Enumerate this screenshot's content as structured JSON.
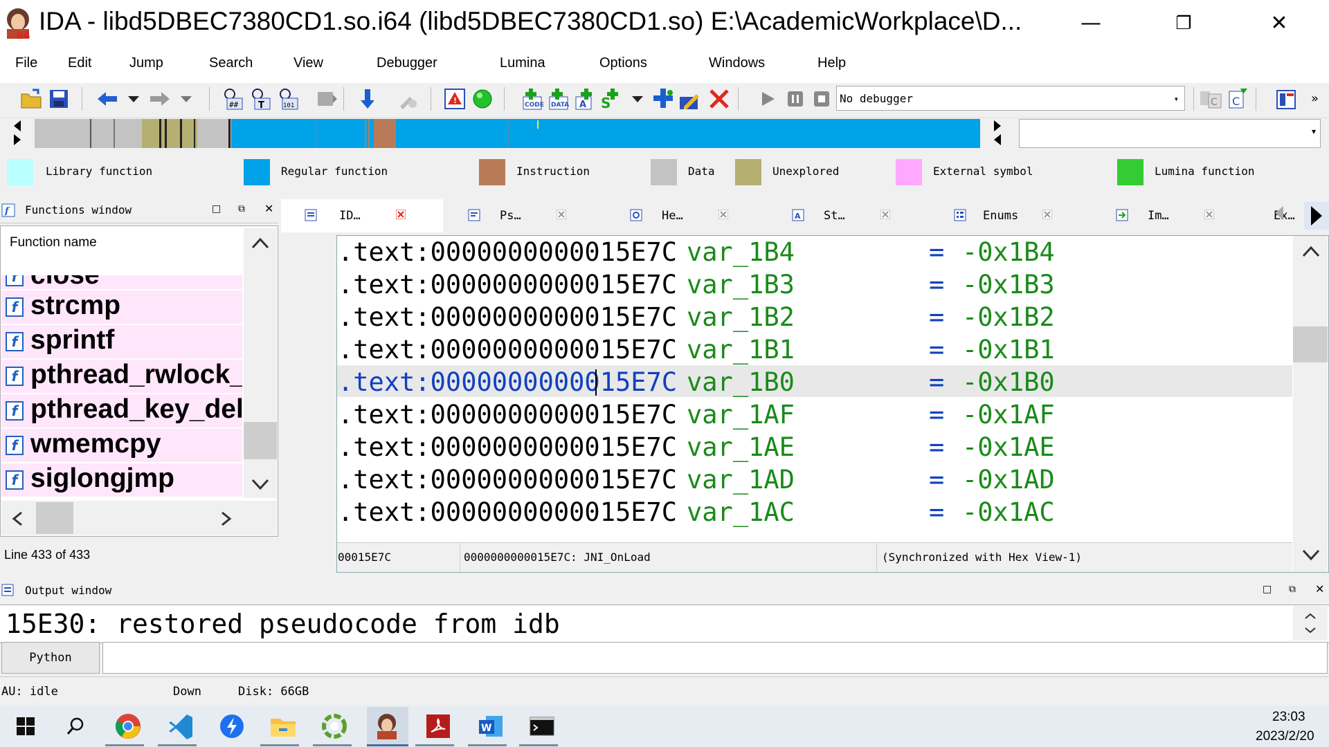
{
  "window": {
    "title": "IDA - libd5DBEC7380CD1.so.i64 (libd5DBEC7380CD1.so) E:\\AcademicWorkplace\\D...",
    "minimize": "—",
    "restore": "❐",
    "close": "✕"
  },
  "menu": [
    "File",
    "Edit",
    "Jump",
    "Search",
    "View",
    "Debugger",
    "Lumina",
    "Options",
    "Windows",
    "Help"
  ],
  "toolbar": {
    "debugger_select": "No debugger",
    "overflow": "»"
  },
  "legend": [
    {
      "label": "Library function",
      "color": "#b9ffff"
    },
    {
      "label": "Regular function",
      "color": "#00a2e8"
    },
    {
      "label": "Instruction",
      "color": "#b97a57"
    },
    {
      "label": "Data",
      "color": "#c3c3c3"
    },
    {
      "label": "Unexplored",
      "color": "#b5b071"
    },
    {
      "label": "External symbol",
      "color": "#ffa8ff"
    },
    {
      "label": "Lumina function",
      "color": "#33cc33"
    }
  ],
  "functions_window": {
    "title": "Functions window",
    "column": "Function name",
    "items": [
      "close",
      "strcmp",
      "sprintf",
      "pthread_rwlock_r",
      "pthread_key_dele",
      "wmemcpy",
      "siglongjmp"
    ],
    "status": "Line 433 of 433"
  },
  "tabs": [
    {
      "label": "ID…"
    },
    {
      "label": "Ps…"
    },
    {
      "label": "He…"
    },
    {
      "label": "St…"
    },
    {
      "label": "Enums"
    },
    {
      "label": "Im…"
    }
  ],
  "tab_next": "Ex…",
  "ida_view": {
    "lines": [
      {
        "addr": ".text:0000000000015E7C",
        "name": "var_1B4",
        "eq": "=",
        "value": "-0x1B4"
      },
      {
        "addr": ".text:0000000000015E7C",
        "name": "var_1B3",
        "eq": "=",
        "value": "-0x1B3"
      },
      {
        "addr": ".text:0000000000015E7C",
        "name": "var_1B2",
        "eq": "=",
        "value": "-0x1B2"
      },
      {
        "addr": ".text:0000000000015E7C",
        "name": "var_1B1",
        "eq": "=",
        "value": "-0x1B1"
      },
      {
        "addr": ".text:0000000000015E7C",
        "name": "var_1B0",
        "eq": "=",
        "value": "-0x1B0"
      },
      {
        "addr": ".text:0000000000015E7C",
        "name": "var_1AF",
        "eq": "=",
        "value": "-0x1AF"
      },
      {
        "addr": ".text:0000000000015E7C",
        "name": "var_1AE",
        "eq": "=",
        "value": "-0x1AE"
      },
      {
        "addr": ".text:0000000000015E7C",
        "name": "var_1AD",
        "eq": "=",
        "value": "-0x1AD"
      },
      {
        "addr": ".text:0000000000015E7C",
        "name": "var_1AC",
        "eq": "=",
        "value": "-0x1AC"
      }
    ],
    "status_offset": "00015E7C",
    "status_location": "0000000000015E7C: JNI_OnLoad",
    "status_sync": "(Synchronized with Hex View-1)"
  },
  "output_window": {
    "title": "Output window",
    "text": "15E30: restored pseudocode from idb",
    "python_button": "Python"
  },
  "statusbar": {
    "au": "AU:  idle",
    "direction": "Down",
    "disk": "Disk: 66GB"
  },
  "taskbar": {
    "time": "23:03",
    "date": "2023/2/20"
  }
}
